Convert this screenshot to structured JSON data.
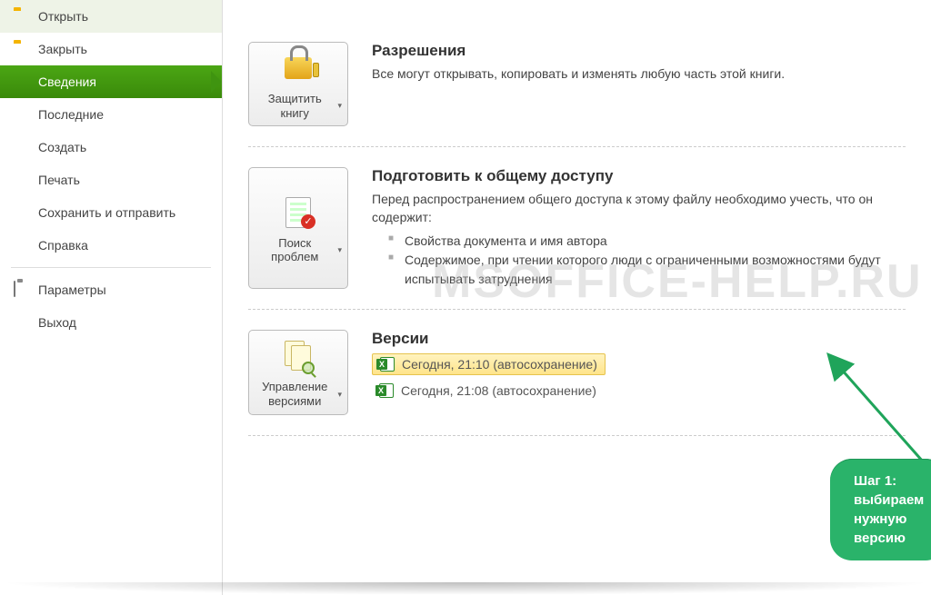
{
  "sidebar": {
    "items": [
      {
        "label": "Открыть",
        "icon": "folder-open-icon"
      },
      {
        "label": "Закрыть",
        "icon": "folder-close-icon"
      },
      {
        "label": "Сведения",
        "selected": true
      },
      {
        "label": "Последние"
      },
      {
        "label": "Создать"
      },
      {
        "label": "Печать"
      },
      {
        "label": "Сохранить и отправить"
      },
      {
        "label": "Справка"
      }
    ],
    "extra": [
      {
        "label": "Параметры",
        "icon": "options-icon"
      },
      {
        "label": "Выход",
        "icon": "exit-icon"
      }
    ]
  },
  "sections": {
    "permissions": {
      "button_label": "Защитить книгу",
      "title": "Разрешения",
      "desc": "Все могут открывать, копировать и изменять любую часть этой книги."
    },
    "prepare": {
      "button_label": "Поиск проблем",
      "title": "Подготовить к общему доступу",
      "desc": "Перед распространением общего доступа к этому файлу необходимо учесть, что он содержит:",
      "bullets": [
        "Свойства документа и имя автора",
        "Содержимое, при чтении которого люди с ограниченными возможностями будут испытывать затруднения"
      ]
    },
    "versions": {
      "button_label": "Управление версиями",
      "title": "Версии",
      "items": [
        {
          "text": "Сегодня, 21:10 (автосохранение)",
          "selected": true
        },
        {
          "text": "Сегодня, 21:08 (автосохранение)",
          "selected": false
        }
      ]
    }
  },
  "callout": {
    "line1": "Шаг 1:",
    "line2": "выбираем нужную версию"
  },
  "watermark": "MSOFFICE-HELP.RU",
  "colors": {
    "accent_green": "#3f9410",
    "callout_green": "#2ab36a",
    "highlight_yellow": "#ffe48a"
  }
}
